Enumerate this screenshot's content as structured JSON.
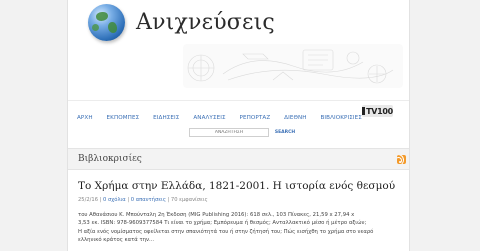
{
  "site": {
    "title": "Ανιχνεύσεις"
  },
  "nav": {
    "items": [
      {
        "label": "ΑΡΧΗ"
      },
      {
        "label": "ΕΚΠΟΜΠΕΣ"
      },
      {
        "label": "ΕΙΔΗΣΕΙΣ"
      },
      {
        "label": "ΑΝΑΛΥΣΕΙΣ"
      },
      {
        "label": "ΡΕΠΟΡΤΑΖ"
      },
      {
        "label": "ΔΙΕΘΝΗ"
      },
      {
        "label": "ΒΙΒΛΙΟΚΡΙΣΙΕΣ"
      }
    ],
    "tv_logo": "TV100"
  },
  "search": {
    "placeholder": "ΑΝΑΖΗΤΗΣΗ",
    "button_label": "SEARCH"
  },
  "section": {
    "title": "Βιβλιοκρισίες",
    "icon": "rss-icon"
  },
  "article": {
    "title": "Το Χρήμα στην Ελλάδα, 1821-2001. Η ιστορία ενός θεσμού",
    "meta": {
      "date": "25/2/16",
      "sep1": " | ",
      "comments": "0 σχόλια",
      "sep2": " | ",
      "replies": "0 απαντήσεις",
      "sep3": " | ",
      "views": "70 εμφανίσεις"
    },
    "body_lines": [
      "του Αθανάσιου Κ. Μπούνταλη 2η Έκδοση (MIG Publishing 2016): 618 σελ., 103 Πίνακες, 21,59 x 27,94 x",
      "3,53 εκ. ISBN: 978-9609377584 Τι είναι το χρήμα; Εμπόρευμα ή θεσμός; Ανταλλακτικό μέσο ή μέτρο αξιών;",
      "Η αξία ενός νομίσματος οφείλεται στην σπανιότητά του ή στην ζήτησή του; Πώς εισήχθη το χρήμα στο νεαρό",
      "ελληνικό κράτος κατά την..."
    ]
  },
  "colors": {
    "link": "#3a6fb5",
    "rss": "#f39a2b",
    "background": "#f2f2f2"
  }
}
